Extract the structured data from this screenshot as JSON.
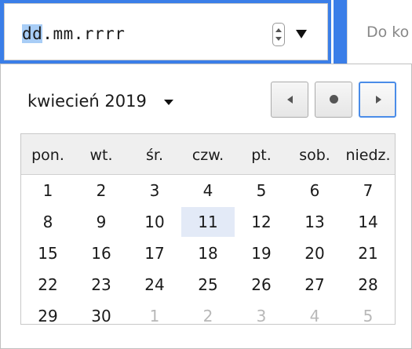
{
  "date_input": {
    "segment_dd": "dd",
    "segment_rest": ".mm.rrrr"
  },
  "to_input": {
    "placeholder": "Do ko"
  },
  "picker": {
    "month_label": "kwiecień 2019",
    "weekdays": [
      "pon.",
      "wt.",
      "śr.",
      "czw.",
      "pt.",
      "sob.",
      "niedz."
    ],
    "weeks": [
      [
        {
          "d": "1"
        },
        {
          "d": "2"
        },
        {
          "d": "3"
        },
        {
          "d": "4"
        },
        {
          "d": "5"
        },
        {
          "d": "6"
        },
        {
          "d": "7"
        }
      ],
      [
        {
          "d": "8"
        },
        {
          "d": "9"
        },
        {
          "d": "10"
        },
        {
          "d": "11",
          "today": true
        },
        {
          "d": "12"
        },
        {
          "d": "13"
        },
        {
          "d": "14"
        }
      ],
      [
        {
          "d": "15"
        },
        {
          "d": "16"
        },
        {
          "d": "17"
        },
        {
          "d": "18"
        },
        {
          "d": "19"
        },
        {
          "d": "20"
        },
        {
          "d": "21"
        }
      ],
      [
        {
          "d": "22"
        },
        {
          "d": "23"
        },
        {
          "d": "24"
        },
        {
          "d": "25"
        },
        {
          "d": "26"
        },
        {
          "d": "27"
        },
        {
          "d": "28"
        }
      ],
      [
        {
          "d": "29"
        },
        {
          "d": "30"
        },
        {
          "d": "1",
          "other": true
        },
        {
          "d": "2",
          "other": true
        },
        {
          "d": "3",
          "other": true
        },
        {
          "d": "4",
          "other": true
        },
        {
          "d": "5",
          "other": true
        }
      ]
    ]
  },
  "colors": {
    "accent_blue": "#3a7ee8",
    "highlight_segment": "#a8cdf6",
    "today_bg": "#e3eaf7"
  },
  "icons": {
    "prev": "triangle-left-icon",
    "today": "dot-icon",
    "next": "triangle-right-icon",
    "dropdown": "triangle-down-icon",
    "spin": "up-down-stepper-icon"
  }
}
